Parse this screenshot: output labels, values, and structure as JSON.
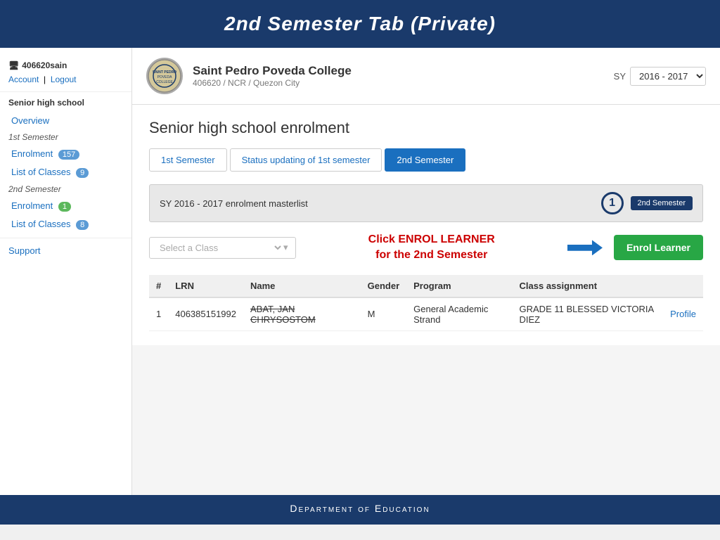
{
  "header": {
    "title": "2nd Semester Tab (Private)"
  },
  "sidebar": {
    "username": "406620sain",
    "account_link": "Account",
    "logout_link": "Logout",
    "section_label": "Senior high school",
    "overview_label": "Overview",
    "first_semester_label": "1st Semester",
    "enrolment_label": "Enrolment",
    "enrolment_badge": "157",
    "list_classes_label": "List of Classes",
    "list_classes_badge": "9",
    "second_semester_label": "2nd Semester",
    "enrolment2_label": "Enrolment",
    "enrolment2_badge": "1",
    "list_classes2_label": "List of Classes",
    "list_classes2_badge": "8",
    "support_label": "Support"
  },
  "school": {
    "name": "Saint Pedro Poveda College",
    "code": "406620 / NCR / Quezon City"
  },
  "sy_selector": {
    "label": "SY",
    "value": "2016 - 2017"
  },
  "content": {
    "section_title": "Senior high school enrolment",
    "tab1": "1st Semester",
    "tab2": "Status updating of 1st semester",
    "tab3": "2nd Semester",
    "masterlist_text": "SY 2016 - 2017 enrolment masterlist",
    "semester_badge": "2nd Semester",
    "circle_number": "1",
    "select_class_placeholder": "Select a Class",
    "enrol_instruction_line1": "Click ENROL LEARNER",
    "enrol_instruction_line2": "for the 2nd Semester",
    "enrol_btn_label": "Enrol Learner"
  },
  "table": {
    "headers": [
      "#",
      "LRN",
      "Name",
      "Gender",
      "Program",
      "Class assignment",
      ""
    ],
    "rows": [
      {
        "num": "1",
        "lrn": "406385151992",
        "name": "ABAT, JAN CHRYSOSTOM",
        "gender": "M",
        "program": "General Academic Strand",
        "class_assignment": "GRADE 11 BLESSED VICTORIA DIEZ",
        "action": "Profile"
      }
    ]
  },
  "footer": {
    "text": "Department of Education"
  }
}
